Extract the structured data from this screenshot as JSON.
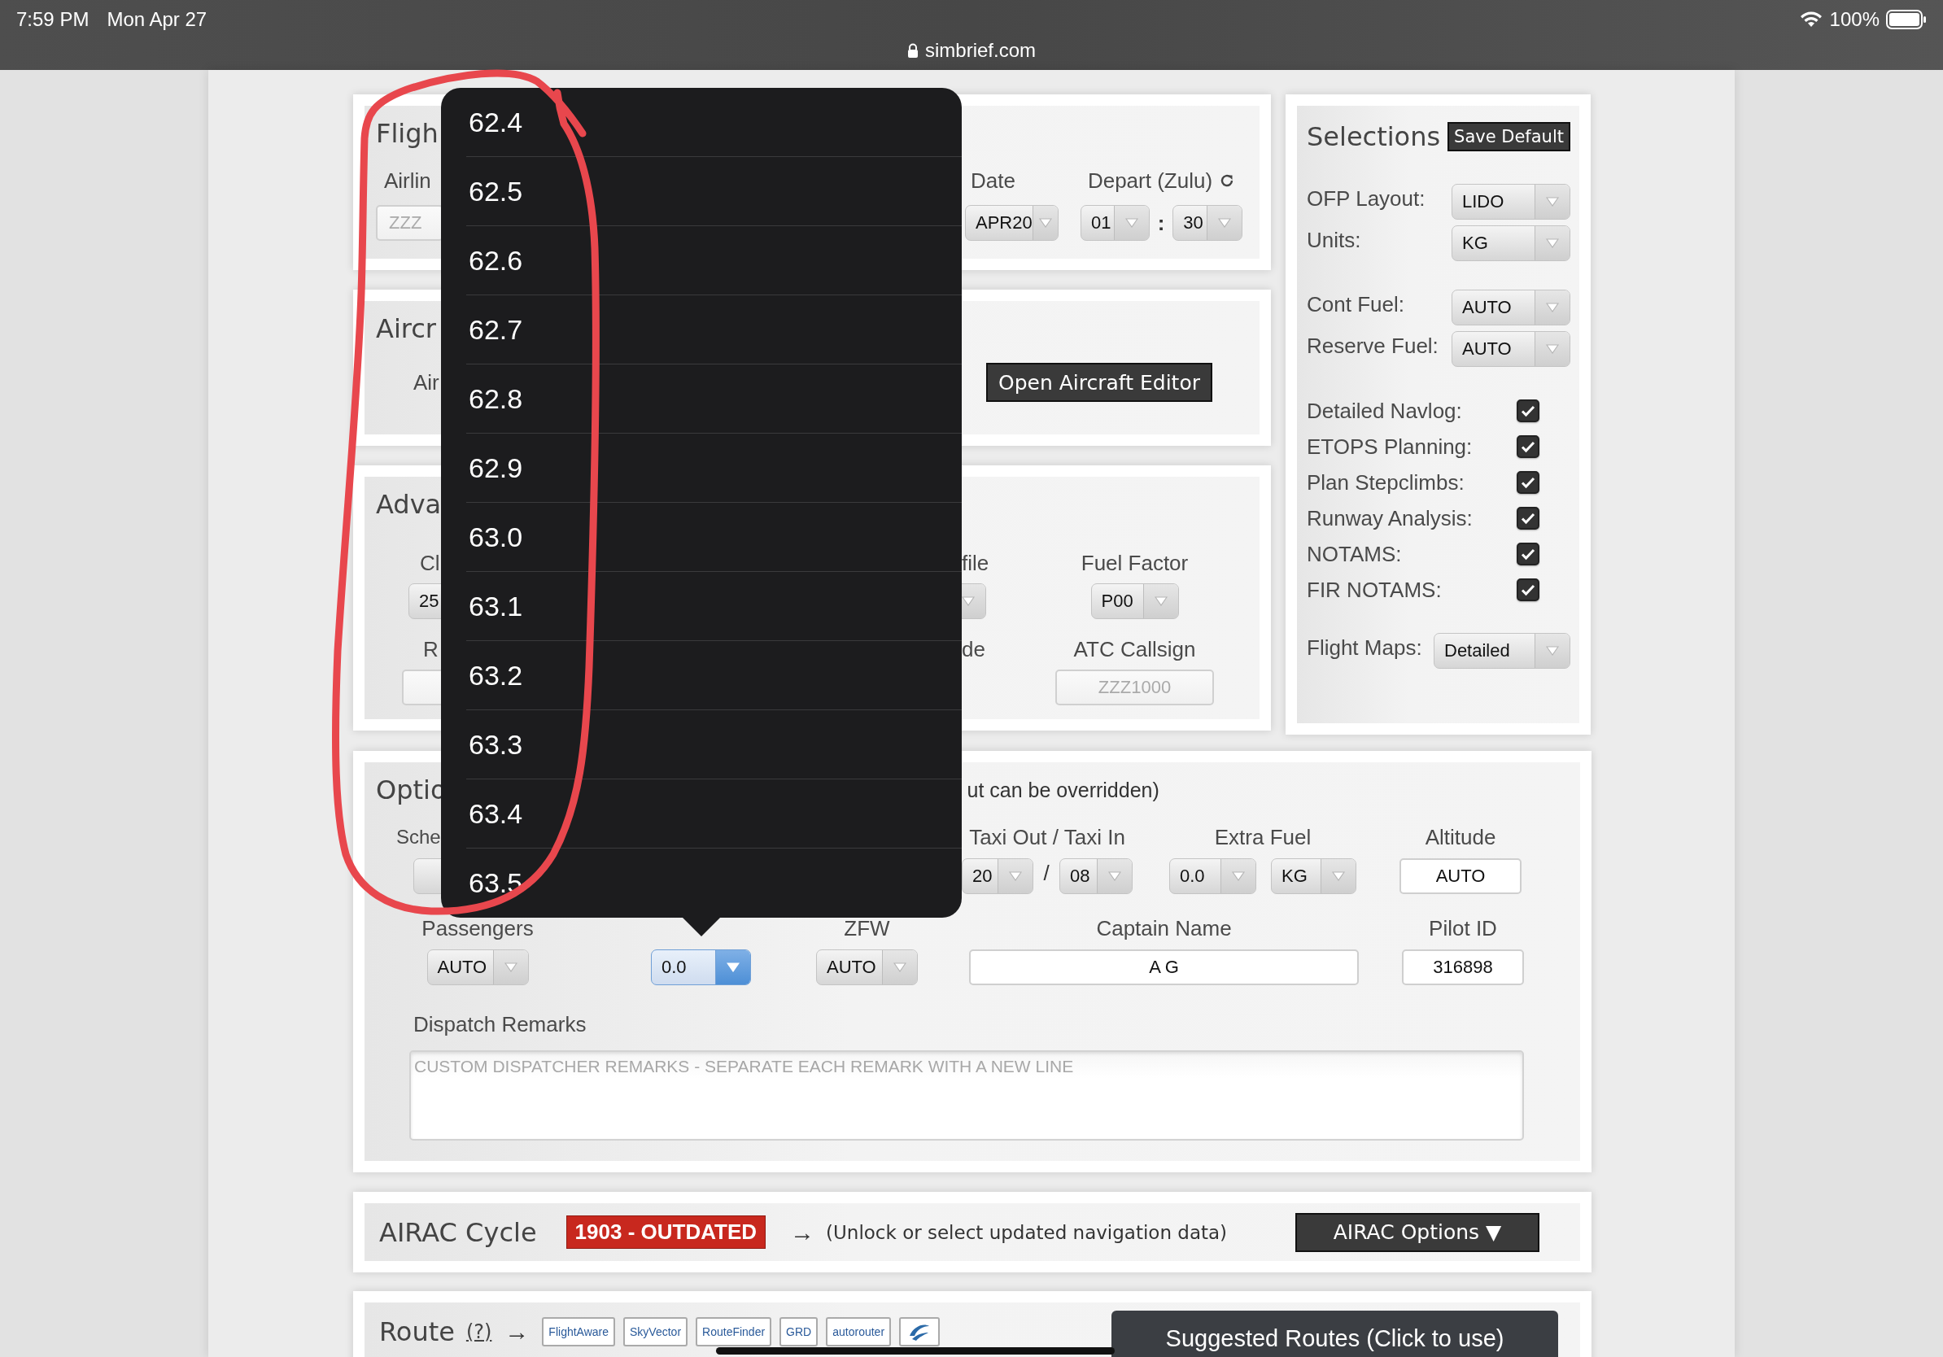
{
  "status_bar": {
    "time": "7:59 PM",
    "date": "Mon Apr 27",
    "url": "simbrief.com",
    "battery": "100%"
  },
  "flight_panel": {
    "title": "Fligh",
    "airline": {
      "label": "Airlin",
      "placeholder": "ZZZ"
    },
    "date": {
      "label": "Date",
      "value": "APR20"
    },
    "depart": {
      "label": "Depart (Zulu)",
      "hour": "01",
      "separator": ":",
      "minute": "30"
    }
  },
  "aircraft_panel": {
    "title": "Aircr",
    "label": "Air",
    "button": "Open Aircraft Editor"
  },
  "advanced_panel": {
    "title": "Adva",
    "climb": {
      "label": "Cl",
      "value": "25"
    },
    "profile_label": "file",
    "fuel_factor": {
      "label": "Fuel Factor",
      "value": "P00"
    },
    "remarks_label": "R",
    "code_label": "de",
    "atc_callsign": {
      "label": "ATC Callsign",
      "placeholder": "ZZZ1000"
    }
  },
  "selections": {
    "title": "Selections",
    "save_button": "Save Default",
    "sections": [
      {
        "rows": [
          {
            "kind": "select",
            "label": "OFP Layout:",
            "value": "LIDO"
          },
          {
            "kind": "select",
            "label": "Units:",
            "value": "KG"
          }
        ]
      },
      {
        "rows": [
          {
            "kind": "select",
            "label": "Cont Fuel:",
            "value": "AUTO"
          },
          {
            "kind": "select",
            "label": "Reserve Fuel:",
            "value": "AUTO"
          }
        ]
      },
      {
        "rows": [
          {
            "kind": "checkbox",
            "label": "Detailed Navlog:",
            "checked": true
          },
          {
            "kind": "checkbox",
            "label": "ETOPS Planning:",
            "checked": true
          },
          {
            "kind": "checkbox",
            "label": "Plan Stepclimbs:",
            "checked": true
          },
          {
            "kind": "checkbox",
            "label": "Runway Analysis:",
            "checked": true
          },
          {
            "kind": "checkbox",
            "label": "NOTAMS:",
            "checked": true
          },
          {
            "kind": "checkbox",
            "label": "FIR NOTAMS:",
            "checked": true
          }
        ]
      },
      {
        "rows": [
          {
            "kind": "select",
            "label": "Flight Maps:",
            "value": "Detailed"
          }
        ]
      }
    ]
  },
  "options_panel": {
    "title": "Optio",
    "note": "ut can be overridden)",
    "schedule_label": "Sche",
    "taxi": {
      "label": "Taxi Out / Taxi In",
      "out": "20",
      "separator": "/",
      "in": "08"
    },
    "extra_fuel": {
      "label": "Extra Fuel",
      "value": "0.0",
      "unit": "KG"
    },
    "altitude": {
      "label": "Altitude",
      "value": "AUTO"
    },
    "passengers": {
      "label": "Passengers",
      "value": "AUTO"
    },
    "cargo": {
      "value": "0.0",
      "focused": true
    },
    "zfw": {
      "label": "ZFW",
      "value": "AUTO"
    },
    "captain": {
      "label": "Captain Name",
      "value": "A G"
    },
    "pilot_id": {
      "label": "Pilot ID",
      "value": "316898"
    },
    "remarks": {
      "label": "Dispatch Remarks",
      "placeholder": "CUSTOM DISPATCHER REMARKS - SEPARATE EACH REMARK WITH A NEW LINE"
    }
  },
  "airac_panel": {
    "title": "AIRAC Cycle",
    "badge": "1903 - OUTDATED",
    "arrow": "→",
    "note": "(Unlock or select updated navigation data)",
    "button": "AIRAC Options",
    "button_caret": "▼"
  },
  "route_panel": {
    "title": "Route",
    "help": "(?)",
    "arrow": "→",
    "tools": [
      {
        "kind": "text",
        "label": "FlightAware"
      },
      {
        "kind": "text",
        "label": "SkyVector"
      },
      {
        "kind": "text",
        "label": "RouteFinder"
      },
      {
        "kind": "text",
        "label": "GRD"
      },
      {
        "kind": "text",
        "label": "autorouter"
      },
      {
        "kind": "icon"
      }
    ],
    "suggested": "Suggested Routes (Click to use)"
  },
  "picker": {
    "options": [
      "62.4",
      "62.5",
      "62.6",
      "62.7",
      "62.8",
      "62.9",
      "63.0",
      "63.1",
      "63.2",
      "63.3",
      "63.4",
      "63.5"
    ]
  }
}
